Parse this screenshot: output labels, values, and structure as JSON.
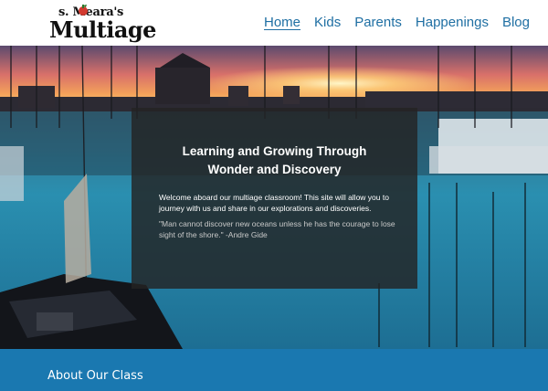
{
  "logo": {
    "small_text": "s. Meara's",
    "big_text": "Multiage"
  },
  "nav": {
    "items": [
      {
        "label": "Home"
      },
      {
        "label": "Kids"
      },
      {
        "label": "Parents"
      },
      {
        "label": "Happenings"
      },
      {
        "label": "Blog"
      }
    ]
  },
  "hero": {
    "heading_line1": "Learning and Growing Through",
    "heading_line2": "Wonder and Discovery",
    "welcome": "Welcome aboard our multiage classroom! This site will allow you to journey with us and share in our explorations and discoveries.",
    "quote": "\"Man cannot discover new oceans unless he has the courage to lose sight of the shore.\" -Andre Gide"
  },
  "footer": {
    "about_title": "About Our Class"
  },
  "colors": {
    "nav_link": "#1f6fa3",
    "footer_band": "#1a78b0",
    "panel_bg": "#232323"
  },
  "icons": {
    "logo_mark": "school-icon"
  }
}
